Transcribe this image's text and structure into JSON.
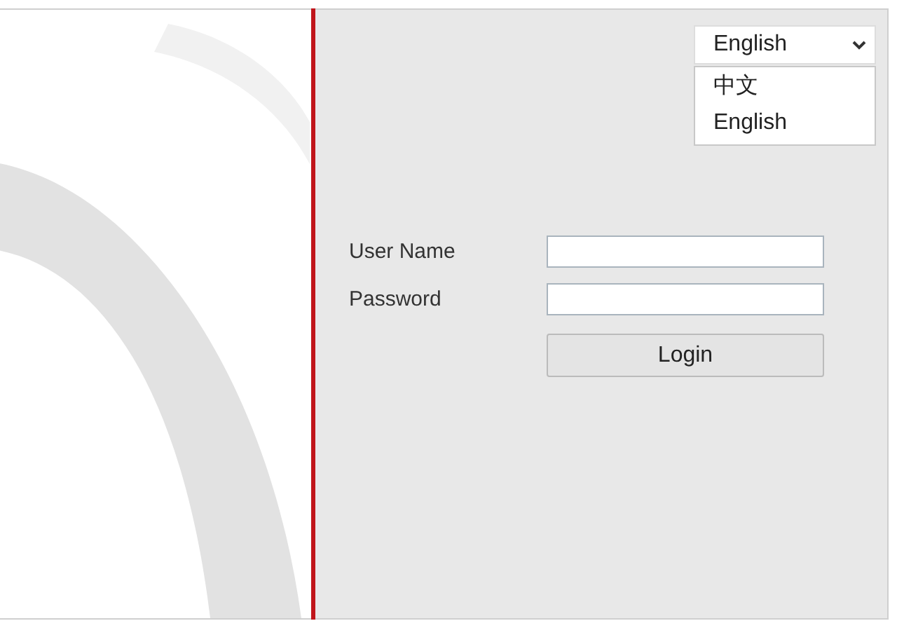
{
  "language_select": {
    "value": "English",
    "options": [
      {
        "label": "中文"
      },
      {
        "label": "English"
      }
    ]
  },
  "form": {
    "fields": [
      {
        "label": "User Name"
      },
      {
        "label": "Password"
      }
    ],
    "button": "Login"
  }
}
